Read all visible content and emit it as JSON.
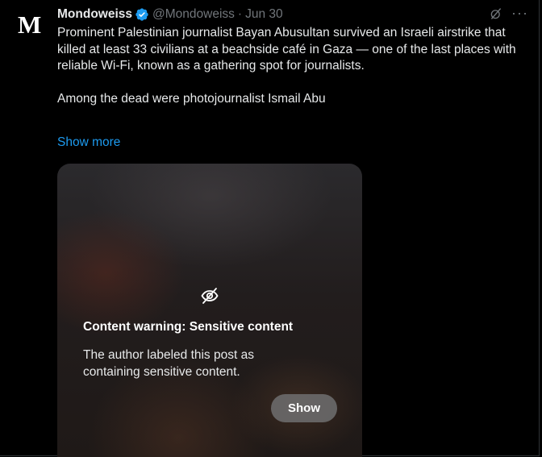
{
  "post": {
    "author_name": "Mondoweiss",
    "avatar_letter": "M",
    "handle": "@Mondoweiss",
    "separator": "·",
    "date": "Jun 30",
    "more_label": "···",
    "text": "Prominent Palestinian journalist Bayan Abusultan survived an Israeli airstrike that killed at least 33 civilians at a beachside café in Gaza — one of the last places with reliable Wi-Fi, known as a gathering spot for journalists.\n\nAmong the dead were photojournalist Ismail Abu",
    "show_more": "Show more"
  },
  "media": {
    "warning_title": "Content warning: Sensitive content",
    "warning_text": "The author labeled this post as containing sensitive content.",
    "show_button": "Show"
  },
  "colors": {
    "background": "#000000",
    "text": "#e7e9ea",
    "secondary": "#71767b",
    "link": "#1d9bf0",
    "verified": "#1d9bf0"
  },
  "icons": {
    "verified": "verified-badge-icon",
    "grok": "grok-icon",
    "more": "more-icon",
    "hidden": "eye-slash-icon"
  }
}
